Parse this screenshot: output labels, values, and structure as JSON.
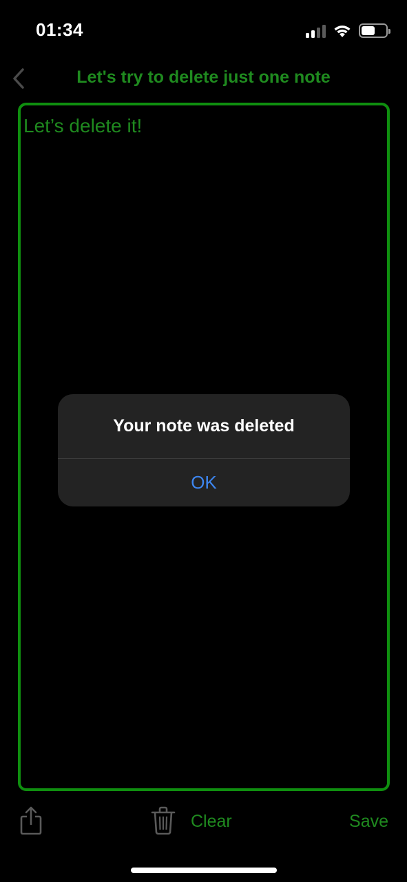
{
  "status_bar": {
    "time": "01:34",
    "signal_icon": "cellular-signal-icon",
    "wifi_icon": "wifi-icon",
    "battery_icon": "battery-icon",
    "battery_level": 0.55
  },
  "nav": {
    "back_icon": "chevron-left-icon",
    "title": "Let's try to delete just one note"
  },
  "editor": {
    "text": "Let’s delete it!"
  },
  "alert": {
    "title": "Your note was deleted",
    "ok_label": "OK"
  },
  "toolbar": {
    "share_icon": "share-icon",
    "trash_icon": "trash-icon",
    "clear_label": "Clear",
    "save_label": "Save"
  },
  "colors": {
    "accent_green": "#1f8a1f",
    "border_green": "#0f8f0f",
    "alert_bg": "#232323",
    "link_blue": "#3d86f0",
    "background": "#000000"
  }
}
